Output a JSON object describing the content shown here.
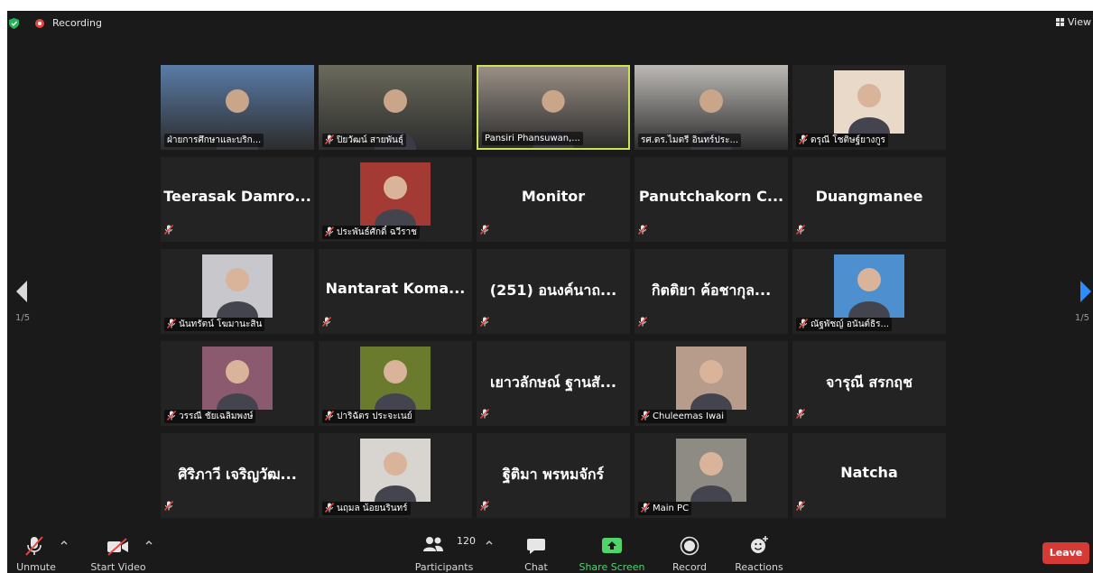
{
  "topbar": {
    "recording_label": "Recording",
    "view_label": "View"
  },
  "pagination": {
    "left": "1/5",
    "right": "1/5"
  },
  "tiles": [
    {
      "name": "ฝ่ายการศึกษาและบริก...",
      "kind": "video",
      "bg": "#5a7ca8",
      "muted": false
    },
    {
      "name": "ปิยวัฒน์ สายพันธุ์",
      "kind": "video",
      "bg": "#6b6a5c",
      "muted": true
    },
    {
      "name": "Pansiri Phansuwan,...",
      "kind": "video",
      "bg": "#9a8f86",
      "muted": false,
      "active": true
    },
    {
      "name": "รศ.ดร.ไมตรี อินทร์ประ...",
      "kind": "video",
      "bg": "#bdbab6",
      "muted": false
    },
    {
      "name": "ดรุณี โชติษฐ์ยางกูร",
      "kind": "photo",
      "bg": "#e8d9c9",
      "muted": true
    },
    {
      "name": "Teerasak Damro...",
      "kind": "name"
    },
    {
      "name": "ประพันธ์ศักดิ์ ฉวีราช",
      "kind": "photo",
      "bg": "#a33a33",
      "muted": true
    },
    {
      "name": "Monitor",
      "kind": "name"
    },
    {
      "name": "Panutchakorn C...",
      "kind": "name"
    },
    {
      "name": "Duangmanee",
      "kind": "name"
    },
    {
      "name": "นันทรัตน์ โฆมานะสิน",
      "kind": "photo",
      "bg": "#c7c7cc",
      "muted": true
    },
    {
      "name": "Nantarat Koma...",
      "kind": "name"
    },
    {
      "name": "(251) อนงค์นาถ...",
      "kind": "name"
    },
    {
      "name": "กิตติยา ค้อชากุล...",
      "kind": "name"
    },
    {
      "name": "ณัฐพัชญ์ อนันต์ธิร...",
      "kind": "photo",
      "bg": "#4d8fcf",
      "muted": true
    },
    {
      "name": "วรรณี ชัยเฉลิมพงษ์",
      "kind": "photo",
      "bg": "#8b5a6e",
      "muted": true
    },
    {
      "name": "ปาริฉัตร ประจะเนย์",
      "kind": "photo",
      "bg": "#6b7b2e",
      "muted": true
    },
    {
      "name": "เยาวลักษณ์ ฐานสั...",
      "kind": "name"
    },
    {
      "name": "Chuleemas Iwai",
      "kind": "photo",
      "bg": "#b79b8b",
      "muted": true
    },
    {
      "name": "จารุณี สรกฤช",
      "kind": "name"
    },
    {
      "name": "ศิริภาวี เจริญวัฒ...",
      "kind": "name"
    },
    {
      "name": "นฤมล น้อยนรินทร์",
      "kind": "photo",
      "bg": "#d8d4cf",
      "muted": true
    },
    {
      "name": "ฐิติมา พรหมจักร์",
      "kind": "name"
    },
    {
      "name": "Main PC",
      "kind": "photo",
      "bg": "#8e8a84",
      "muted": true
    },
    {
      "name": "Natcha",
      "kind": "name"
    }
  ],
  "toolbar": {
    "unmute": "Unmute",
    "start_video": "Start Video",
    "participants": "Participants",
    "participants_count": "120",
    "chat": "Chat",
    "share_screen": "Share Screen",
    "record": "Record",
    "reactions": "Reactions",
    "leave": "Leave"
  },
  "colors": {
    "share_green": "#4fd46a",
    "leave_red": "#d63a36",
    "active_border": "#c9e357",
    "muted_red": "#e8453c"
  }
}
